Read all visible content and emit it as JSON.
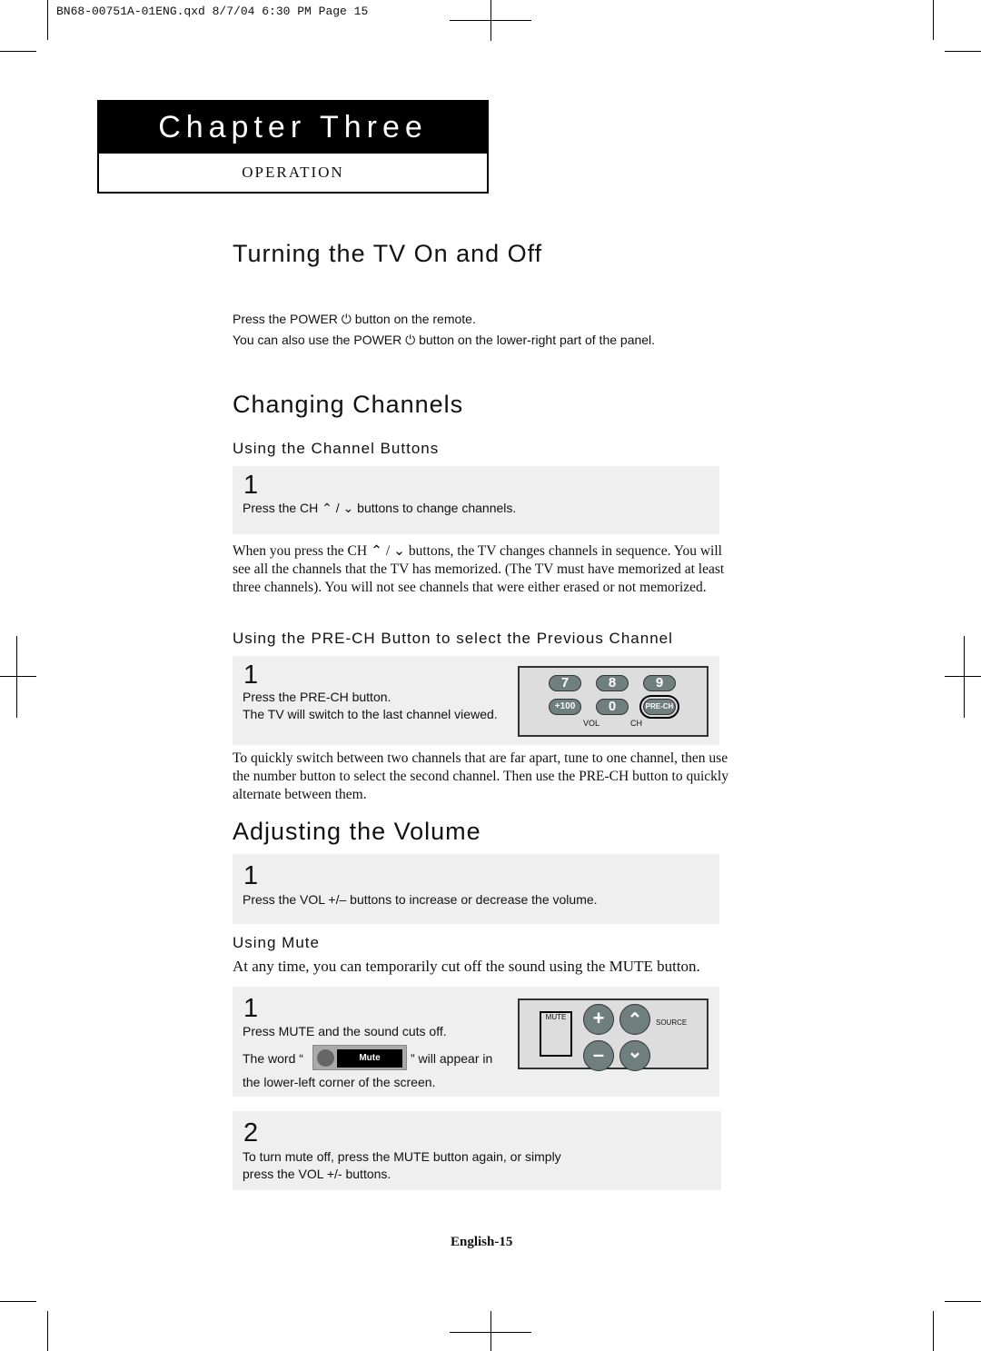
{
  "print_header": "BN68-00751A-01ENG.qxd   8/7/04  6:30  PM   Page  15",
  "chapter": {
    "title": "Chapter Three",
    "subtitle": "OPERATION"
  },
  "sections": {
    "power": {
      "title": "Turning the TV On and Off",
      "line1": "Press the POWER ⏻ button on the remote.",
      "line2": "You can also use the POWER ⏻ button on the lower-right part of the panel."
    },
    "channels": {
      "title": "Changing Channels",
      "sub1": "Using the Channel Buttons",
      "step1_num": "1",
      "step1_text": "Press the CH ⌃ / ⌄ buttons to change channels.",
      "para1": "When you press the CH ⌃ / ⌄ buttons, the TV changes channels in sequence. You will see all the channels that the TV has memorized. (The TV must have memorized at least three channels). You will not see channels that were either erased or not memorized.",
      "sub2": "Using the PRE-CH Button to select the Previous Channel",
      "step2_num": "1",
      "step2_line1": "Press the PRE-CH button.",
      "step2_line2": "The TV will switch to the last channel viewed.",
      "remote_keys": [
        "7",
        "8",
        "9",
        "+100",
        "0",
        "PRE-CH",
        "VOL",
        "CH"
      ],
      "para2": "To quickly switch between two channels that are far apart, tune to one channel, then use the number button to select the second channel. Then use the PRE-CH button to quickly alternate between them."
    },
    "volume": {
      "title": "Adjusting the Volume",
      "step1_num": "1",
      "step1_text": "Press the VOL +/– buttons to increase or decrease the volume.",
      "sub_mute": "Using Mute",
      "mute_intro": "At any time, you can temporarily cut off the sound using the MUTE  button.",
      "mute1_num": "1",
      "mute1_line1": "Press MUTE and the sound cuts off.",
      "mute1_pre": "The word “",
      "mute_osd": "Mute",
      "mute1_post": "” will appear in",
      "mute1_line3": "the lower-left corner of the screen.",
      "remote_keys": [
        "MUTE",
        "+",
        "–",
        "⌃",
        "⌄",
        "SOURCE"
      ],
      "mute2_num": "2",
      "mute2_line1": "To turn mute off, press the MUTE button again, or simply",
      "mute2_line2": "press the VOL +/- buttons."
    }
  },
  "footer": {
    "page": "English-15"
  }
}
